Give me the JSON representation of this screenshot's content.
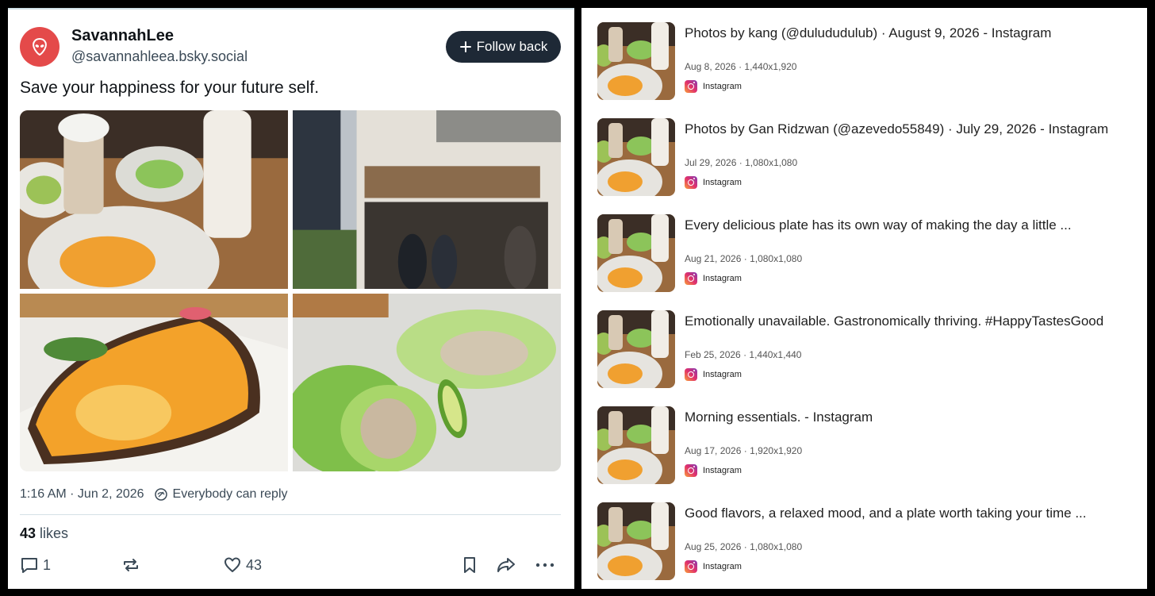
{
  "post": {
    "display_name": "SavannahLee",
    "handle": "@savannahleea.bsky.social",
    "follow_label": "Follow back",
    "text": "Save your happiness for your future self.",
    "time": "1:16 AM · Jun 2, 2026",
    "reply_setting": "Everybody can reply",
    "likes_count": "43",
    "likes_label": "likes",
    "reply_count": "1",
    "like_count": "43",
    "brand_color": "#1e2936",
    "avatar_color": "#e44a4a",
    "images": [
      {
        "name": "cafe-table-photo",
        "icon": "photo"
      },
      {
        "name": "storefront-photo",
        "icon": "photo"
      },
      {
        "name": "egg-toast-photo",
        "icon": "photo"
      },
      {
        "name": "lettuce-wrap-photo",
        "icon": "photo"
      }
    ]
  },
  "results": [
    {
      "title": "Photos by kang (@dulududulub) · August 9, 2026 - Instagram",
      "date": "Aug 8, 2026",
      "size": "1,440x1,920",
      "source": "Instagram"
    },
    {
      "title": "Photos by Gan Ridzwan (@azevedo55849) · July 29, 2026 - Instagram",
      "date": "Jul 29, 2026",
      "size": "1,080x1,080",
      "source": "Instagram"
    },
    {
      "title": "Every delicious plate has its own way of making the day a little ...",
      "date": "Aug 21, 2026",
      "size": "1,080x1,080",
      "source": "Instagram"
    },
    {
      "title": "Emotionally unavailable. Gastronomically thriving. #HappyTastesGood",
      "date": "Feb 25, 2026",
      "size": "1,440x1,440",
      "source": "Instagram"
    },
    {
      "title": "Morning essentials. - Instagram",
      "date": "Aug 17, 2026",
      "size": "1,920x1,920",
      "source": "Instagram"
    },
    {
      "title": "Good flavors, a relaxed mood, and a plate worth taking your time ...",
      "date": "Aug 25, 2026",
      "size": "1,080x1,080",
      "source": "Instagram"
    }
  ]
}
